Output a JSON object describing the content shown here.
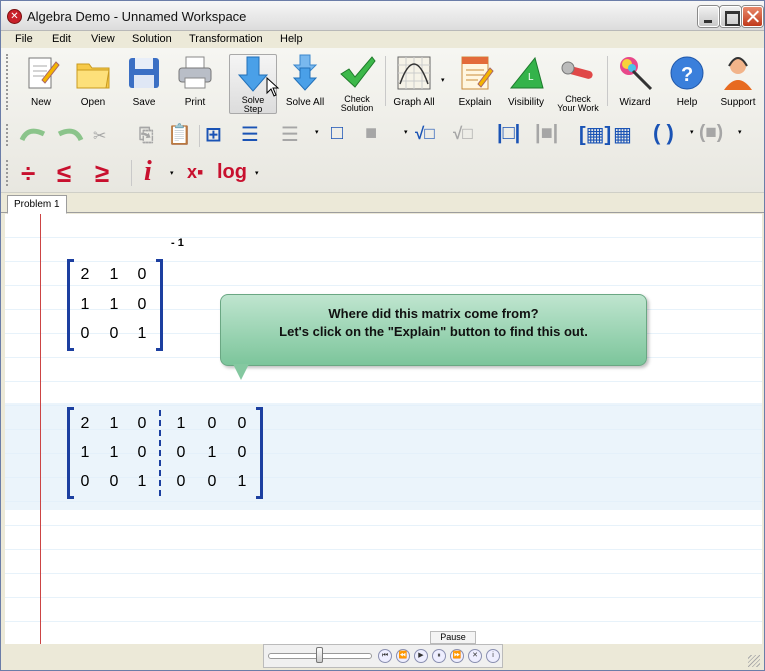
{
  "window": {
    "title": "Algebra Demo - Unnamed Workspace"
  },
  "menu": [
    "File",
    "Edit",
    "View",
    "Solution",
    "Transformation",
    "Help"
  ],
  "toolbar": {
    "new": "New",
    "open": "Open",
    "save": "Save",
    "print": "Print",
    "solve_step_1": "Solve",
    "solve_step_2": "Step",
    "solve_all": "Solve All",
    "check_solution_1": "Check",
    "check_solution_2": "Solution",
    "graph_all": "Graph All",
    "explain": "Explain",
    "visibility": "Visibility",
    "check_work_1": "Check",
    "check_work_2": "Your Work",
    "wizard": "Wizard",
    "help": "Help",
    "support": "Support"
  },
  "symbols": {
    "divide": "÷",
    "le": "≤",
    "ge": "≥",
    "i": "i",
    "x": "x",
    "log": "log",
    "paren_open": "(",
    "paren_close": ")"
  },
  "tabs": [
    "Problem 1"
  ],
  "matrix1": {
    "exponent": "- 1",
    "rows": [
      [
        "2",
        "1",
        "0"
      ],
      [
        "1",
        "1",
        "0"
      ],
      [
        "0",
        "0",
        "1"
      ]
    ]
  },
  "matrix2": {
    "rows": [
      [
        "2",
        "1",
        "0",
        "1",
        "0",
        "0"
      ],
      [
        "1",
        "1",
        "0",
        "0",
        "1",
        "0"
      ],
      [
        "0",
        "0",
        "1",
        "0",
        "0",
        "1"
      ]
    ]
  },
  "callout": {
    "line1": "Where did this matrix come from?",
    "line2": "Let's click on the \"Explain\" button to find this out."
  },
  "player": {
    "pause_label": "Pause"
  },
  "colors": {
    "accent": "#1c3fa0",
    "callout": "#7cc59b",
    "margin": "#cc4444"
  }
}
